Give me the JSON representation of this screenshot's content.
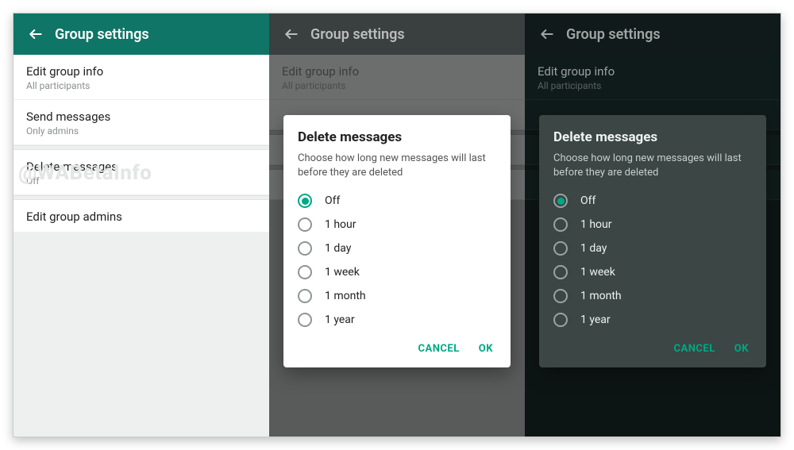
{
  "header": {
    "title": "Group settings"
  },
  "watermark": "@WABetaInfo",
  "settings": [
    {
      "title": "Edit group info",
      "sub": "All participants"
    },
    {
      "title": "Send messages",
      "sub": "Only admins"
    },
    {
      "title": "Delete messages",
      "sub": "Off"
    },
    {
      "title": "Edit group admins",
      "sub": ""
    }
  ],
  "dialog": {
    "title": "Delete messages",
    "desc": "Choose how long new messages will last before they are deleted",
    "options": [
      "Off",
      "1 hour",
      "1 day",
      "1 week",
      "1 month",
      "1 year"
    ],
    "selected": "Off",
    "cancel": "CANCEL",
    "ok": "OK"
  },
  "colors": {
    "accent": "#00a884",
    "header_light": "#0f7566"
  }
}
